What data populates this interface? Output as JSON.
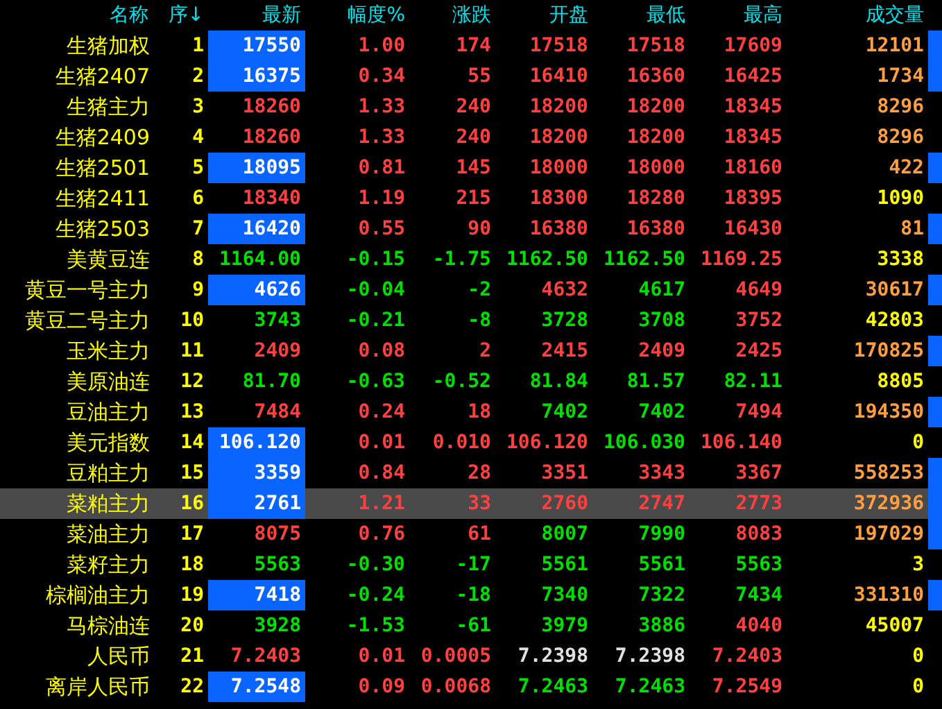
{
  "columns": [
    "名称",
    "序↓",
    "最新",
    "幅度%",
    "涨跌",
    "开盘",
    "最低",
    "最高",
    "成交量"
  ],
  "rows": [
    {
      "name": "生猪加权",
      "no": "1",
      "selected": false,
      "marker": true,
      "latest": {
        "text": "17550",
        "color": "#ffffff",
        "highlighted": true
      },
      "cols": [
        {
          "text": "1.00",
          "color": "#ff4040"
        },
        {
          "text": "174",
          "color": "#ff4040"
        },
        {
          "text": "17518",
          "color": "#ff4040"
        },
        {
          "text": "17518",
          "color": "#ff4040"
        },
        {
          "text": "17609",
          "color": "#ff4040"
        },
        {
          "text": "12101",
          "color": "#ff9f40"
        }
      ]
    },
    {
      "name": "生猪2407",
      "no": "2",
      "selected": false,
      "marker": true,
      "latest": {
        "text": "16375",
        "color": "#ffffff",
        "highlighted": true
      },
      "cols": [
        {
          "text": "0.34",
          "color": "#ff4040"
        },
        {
          "text": "55",
          "color": "#ff4040"
        },
        {
          "text": "16410",
          "color": "#ff4040"
        },
        {
          "text": "16360",
          "color": "#ff4040"
        },
        {
          "text": "16425",
          "color": "#ff4040"
        },
        {
          "text": "1734",
          "color": "#ff9f40"
        }
      ]
    },
    {
      "name": "生猪主力",
      "no": "3",
      "selected": false,
      "marker": false,
      "latest": {
        "text": "18260",
        "color": "#ff4040",
        "highlighted": false
      },
      "cols": [
        {
          "text": "1.33",
          "color": "#ff4040"
        },
        {
          "text": "240",
          "color": "#ff4040"
        },
        {
          "text": "18200",
          "color": "#ff4040"
        },
        {
          "text": "18200",
          "color": "#ff4040"
        },
        {
          "text": "18345",
          "color": "#ff4040"
        },
        {
          "text": "8296",
          "color": "#ff9f40"
        }
      ]
    },
    {
      "name": "生猪2409",
      "no": "4",
      "selected": false,
      "marker": false,
      "latest": {
        "text": "18260",
        "color": "#ff4040",
        "highlighted": false
      },
      "cols": [
        {
          "text": "1.33",
          "color": "#ff4040"
        },
        {
          "text": "240",
          "color": "#ff4040"
        },
        {
          "text": "18200",
          "color": "#ff4040"
        },
        {
          "text": "18200",
          "color": "#ff4040"
        },
        {
          "text": "18345",
          "color": "#ff4040"
        },
        {
          "text": "8296",
          "color": "#ff9f40"
        }
      ]
    },
    {
      "name": "生猪2501",
      "no": "5",
      "selected": false,
      "marker": true,
      "latest": {
        "text": "18095",
        "color": "#ffffff",
        "highlighted": true
      },
      "cols": [
        {
          "text": "0.81",
          "color": "#ff4040"
        },
        {
          "text": "145",
          "color": "#ff4040"
        },
        {
          "text": "18000",
          "color": "#ff4040"
        },
        {
          "text": "18000",
          "color": "#ff4040"
        },
        {
          "text": "18160",
          "color": "#ff4040"
        },
        {
          "text": "422",
          "color": "#ff9f40"
        }
      ]
    },
    {
      "name": "生猪2411",
      "no": "6",
      "selected": false,
      "marker": false,
      "latest": {
        "text": "18340",
        "color": "#ff4040",
        "highlighted": false
      },
      "cols": [
        {
          "text": "1.19",
          "color": "#ff4040"
        },
        {
          "text": "215",
          "color": "#ff4040"
        },
        {
          "text": "18300",
          "color": "#ff4040"
        },
        {
          "text": "18280",
          "color": "#ff4040"
        },
        {
          "text": "18395",
          "color": "#ff4040"
        },
        {
          "text": "1090",
          "color": "#ffff00"
        }
      ]
    },
    {
      "name": "生猪2503",
      "no": "7",
      "selected": false,
      "marker": true,
      "latest": {
        "text": "16420",
        "color": "#ffffff",
        "highlighted": true
      },
      "cols": [
        {
          "text": "0.55",
          "color": "#ff4040"
        },
        {
          "text": "90",
          "color": "#ff4040"
        },
        {
          "text": "16380",
          "color": "#ff4040"
        },
        {
          "text": "16380",
          "color": "#ff4040"
        },
        {
          "text": "16430",
          "color": "#ff4040"
        },
        {
          "text": "81",
          "color": "#ff9f40"
        }
      ]
    },
    {
      "name": "美黄豆连",
      "no": "8",
      "selected": false,
      "marker": false,
      "latest": {
        "text": "1164.00",
        "color": "#00e000",
        "highlighted": false
      },
      "cols": [
        {
          "text": "-0.15",
          "color": "#00e000"
        },
        {
          "text": "-1.75",
          "color": "#00e000"
        },
        {
          "text": "1162.50",
          "color": "#00e000"
        },
        {
          "text": "1162.50",
          "color": "#00e000"
        },
        {
          "text": "1169.25",
          "color": "#ff4040"
        },
        {
          "text": "3338",
          "color": "#ffff00"
        }
      ]
    },
    {
      "name": "黄豆一号主力",
      "no": "9",
      "selected": false,
      "marker": true,
      "latest": {
        "text": "4626",
        "color": "#ffffff",
        "highlighted": true
      },
      "cols": [
        {
          "text": "-0.04",
          "color": "#00e000"
        },
        {
          "text": "-2",
          "color": "#00e000"
        },
        {
          "text": "4632",
          "color": "#ff4040"
        },
        {
          "text": "4617",
          "color": "#00e000"
        },
        {
          "text": "4649",
          "color": "#ff4040"
        },
        {
          "text": "30617",
          "color": "#ff9f40"
        }
      ]
    },
    {
      "name": "黄豆二号主力",
      "no": "10",
      "selected": false,
      "marker": false,
      "latest": {
        "text": "3743",
        "color": "#00e000",
        "highlighted": false
      },
      "cols": [
        {
          "text": "-0.21",
          "color": "#00e000"
        },
        {
          "text": "-8",
          "color": "#00e000"
        },
        {
          "text": "3728",
          "color": "#00e000"
        },
        {
          "text": "3708",
          "color": "#00e000"
        },
        {
          "text": "3752",
          "color": "#ff4040"
        },
        {
          "text": "42803",
          "color": "#ffff00"
        }
      ]
    },
    {
      "name": "玉米主力",
      "no": "11",
      "selected": false,
      "marker": true,
      "latest": {
        "text": "2409",
        "color": "#ff4040",
        "highlighted": false
      },
      "cols": [
        {
          "text": "0.08",
          "color": "#ff4040"
        },
        {
          "text": "2",
          "color": "#ff4040"
        },
        {
          "text": "2415",
          "color": "#ff4040"
        },
        {
          "text": "2409",
          "color": "#ff4040"
        },
        {
          "text": "2425",
          "color": "#ff4040"
        },
        {
          "text": "170825",
          "color": "#ff9f40"
        }
      ]
    },
    {
      "name": "美原油连",
      "no": "12",
      "selected": false,
      "marker": false,
      "latest": {
        "text": "81.70",
        "color": "#00e000",
        "highlighted": false
      },
      "cols": [
        {
          "text": "-0.63",
          "color": "#00e000"
        },
        {
          "text": "-0.52",
          "color": "#00e000"
        },
        {
          "text": "81.84",
          "color": "#00e000"
        },
        {
          "text": "81.57",
          "color": "#00e000"
        },
        {
          "text": "82.11",
          "color": "#00e000"
        },
        {
          "text": "8805",
          "color": "#ffff00"
        }
      ]
    },
    {
      "name": "豆油主力",
      "no": "13",
      "selected": false,
      "marker": true,
      "latest": {
        "text": "7484",
        "color": "#ff4040",
        "highlighted": false
      },
      "cols": [
        {
          "text": "0.24",
          "color": "#ff4040"
        },
        {
          "text": "18",
          "color": "#ff4040"
        },
        {
          "text": "7402",
          "color": "#00e000"
        },
        {
          "text": "7402",
          "color": "#00e000"
        },
        {
          "text": "7494",
          "color": "#ff4040"
        },
        {
          "text": "194350",
          "color": "#ff9f40"
        }
      ]
    },
    {
      "name": "美元指数",
      "no": "14",
      "selected": false,
      "marker": false,
      "latest": {
        "text": "106.120",
        "color": "#ffffff",
        "highlighted": true
      },
      "cols": [
        {
          "text": "0.01",
          "color": "#ff4040"
        },
        {
          "text": "0.010",
          "color": "#ff4040"
        },
        {
          "text": "106.120",
          "color": "#ff4040"
        },
        {
          "text": "106.030",
          "color": "#00e000"
        },
        {
          "text": "106.140",
          "color": "#ff4040"
        },
        {
          "text": "0",
          "color": "#ffff00"
        }
      ]
    },
    {
      "name": "豆粕主力",
      "no": "15",
      "selected": false,
      "marker": true,
      "latest": {
        "text": "3359",
        "color": "#ffffff",
        "highlighted": true
      },
      "cols": [
        {
          "text": "0.84",
          "color": "#ff4040"
        },
        {
          "text": "28",
          "color": "#ff4040"
        },
        {
          "text": "3351",
          "color": "#ff4040"
        },
        {
          "text": "3343",
          "color": "#ff4040"
        },
        {
          "text": "3367",
          "color": "#ff4040"
        },
        {
          "text": "558253",
          "color": "#ff9f40"
        }
      ]
    },
    {
      "name": "菜粕主力",
      "no": "16",
      "selected": true,
      "marker": true,
      "latest": {
        "text": "2761",
        "color": "#ffffff",
        "highlighted": true
      },
      "cols": [
        {
          "text": "1.21",
          "color": "#ff4040"
        },
        {
          "text": "33",
          "color": "#ff4040"
        },
        {
          "text": "2760",
          "color": "#ff4040"
        },
        {
          "text": "2747",
          "color": "#ff4040"
        },
        {
          "text": "2773",
          "color": "#ff4040"
        },
        {
          "text": "372936",
          "color": "#ff9f40"
        }
      ]
    },
    {
      "name": "菜油主力",
      "no": "17",
      "selected": false,
      "marker": true,
      "latest": {
        "text": "8075",
        "color": "#ff4040",
        "highlighted": false
      },
      "cols": [
        {
          "text": "0.76",
          "color": "#ff4040"
        },
        {
          "text": "61",
          "color": "#ff4040"
        },
        {
          "text": "8007",
          "color": "#00e000"
        },
        {
          "text": "7990",
          "color": "#00e000"
        },
        {
          "text": "8083",
          "color": "#ff4040"
        },
        {
          "text": "197029",
          "color": "#ff9f40"
        }
      ]
    },
    {
      "name": "菜籽主力",
      "no": "18",
      "selected": false,
      "marker": false,
      "latest": {
        "text": "5563",
        "color": "#00e000",
        "highlighted": false
      },
      "cols": [
        {
          "text": "-0.30",
          "color": "#00e000"
        },
        {
          "text": "-17",
          "color": "#00e000"
        },
        {
          "text": "5561",
          "color": "#00e000"
        },
        {
          "text": "5561",
          "color": "#00e000"
        },
        {
          "text": "5563",
          "color": "#00e000"
        },
        {
          "text": "3",
          "color": "#ffff00"
        }
      ]
    },
    {
      "name": "棕榈油主力",
      "no": "19",
      "selected": false,
      "marker": true,
      "latest": {
        "text": "7418",
        "color": "#ffffff",
        "highlighted": true
      },
      "cols": [
        {
          "text": "-0.24",
          "color": "#00e000"
        },
        {
          "text": "-18",
          "color": "#00e000"
        },
        {
          "text": "7340",
          "color": "#00e000"
        },
        {
          "text": "7322",
          "color": "#00e000"
        },
        {
          "text": "7434",
          "color": "#00e000"
        },
        {
          "text": "331310",
          "color": "#ff9f40"
        }
      ]
    },
    {
      "name": "马棕油连",
      "no": "20",
      "selected": false,
      "marker": false,
      "latest": {
        "text": "3928",
        "color": "#00e000",
        "highlighted": false
      },
      "cols": [
        {
          "text": "-1.53",
          "color": "#00e000"
        },
        {
          "text": "-61",
          "color": "#00e000"
        },
        {
          "text": "3979",
          "color": "#00e000"
        },
        {
          "text": "3886",
          "color": "#00e000"
        },
        {
          "text": "4040",
          "color": "#ff4040"
        },
        {
          "text": "45007",
          "color": "#ffff00"
        }
      ]
    },
    {
      "name": "人民币",
      "no": "21",
      "selected": false,
      "marker": false,
      "latest": {
        "text": "7.2403",
        "color": "#ff4040",
        "highlighted": false
      },
      "cols": [
        {
          "text": "0.01",
          "color": "#ff4040"
        },
        {
          "text": "0.0005",
          "color": "#ff4040"
        },
        {
          "text": "7.2398",
          "color": "#e0e0e0"
        },
        {
          "text": "7.2398",
          "color": "#e0e0e0"
        },
        {
          "text": "7.2403",
          "color": "#ff4040"
        },
        {
          "text": "0",
          "color": "#ffff00"
        }
      ]
    },
    {
      "name": "离岸人民币",
      "no": "22",
      "selected": false,
      "marker": false,
      "latest": {
        "text": "7.2548",
        "color": "#ffffff",
        "highlighted": true
      },
      "cols": [
        {
          "text": "0.09",
          "color": "#ff4040"
        },
        {
          "text": "0.0068",
          "color": "#ff4040"
        },
        {
          "text": "7.2463",
          "color": "#00e000"
        },
        {
          "text": "7.2463",
          "color": "#00e000"
        },
        {
          "text": "7.2549",
          "color": "#ff4040"
        },
        {
          "text": "0",
          "color": "#ffff00"
        }
      ]
    }
  ]
}
